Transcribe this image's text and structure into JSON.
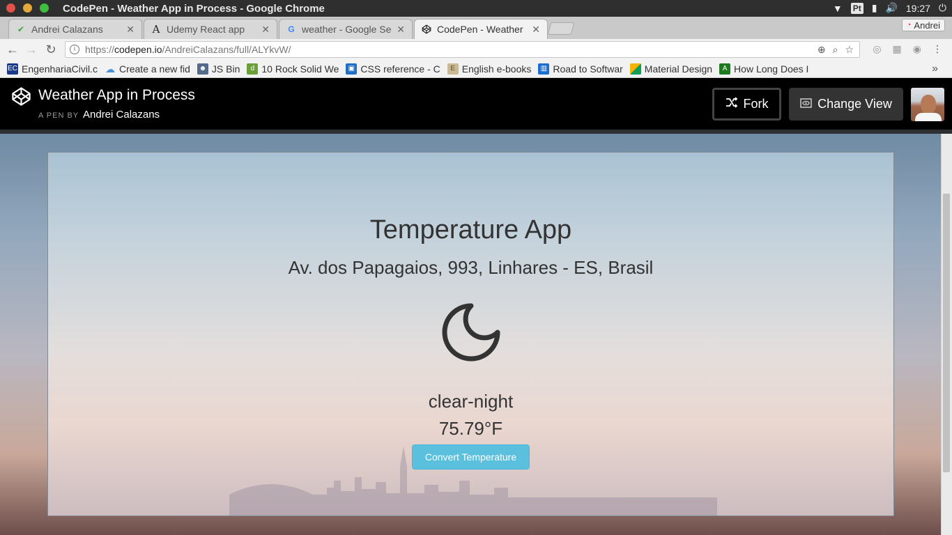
{
  "os": {
    "window_title": "CodePen - Weather App in Process - Google Chrome",
    "keyboard_layout": "Pt",
    "clock": "19:27"
  },
  "tabs": [
    {
      "label": "Andrei Calazans",
      "active": false
    },
    {
      "label": "Udemy React app",
      "active": false
    },
    {
      "label": "weather - Google Se",
      "active": false
    },
    {
      "label": "CodePen - Weather",
      "active": true
    }
  ],
  "profile_name": "Andrei",
  "address_bar": {
    "protocol": "https://",
    "host": "codepen.io",
    "path": "/AndreiCalazans/full/ALYkvW/"
  },
  "bookmarks": [
    {
      "label": "EngenhariaCivil.c",
      "color": "#1a3a8c"
    },
    {
      "label": "Create a new fid",
      "color": "#4a90d9"
    },
    {
      "label": "JS Bin",
      "color": "#556b8a"
    },
    {
      "label": "10 Rock Solid We",
      "color": "#6a9f3a"
    },
    {
      "label": "CSS reference - C",
      "color": "#1f6fc2"
    },
    {
      "label": "English e-books",
      "color": "#8a7a5a"
    },
    {
      "label": "Road to Softwar",
      "color": "#1c6fd1"
    },
    {
      "label": "Material Design",
      "color": "#f4b400"
    },
    {
      "label": "How Long Does I",
      "color": "#1e7a1e"
    }
  ],
  "codepen": {
    "pen_title": "Weather App in Process",
    "by_label": "A PEN BY",
    "author": "Andrei Calazans",
    "fork_label": "Fork",
    "change_view_label": "Change View"
  },
  "app": {
    "title": "Temperature App",
    "address": "Av. dos Papagaios, 993, Linhares - ES, Brasil",
    "icon": "moon-icon",
    "summary": "clear-night",
    "temperature": "75.79°F",
    "convert_label": "Convert Temperature"
  }
}
